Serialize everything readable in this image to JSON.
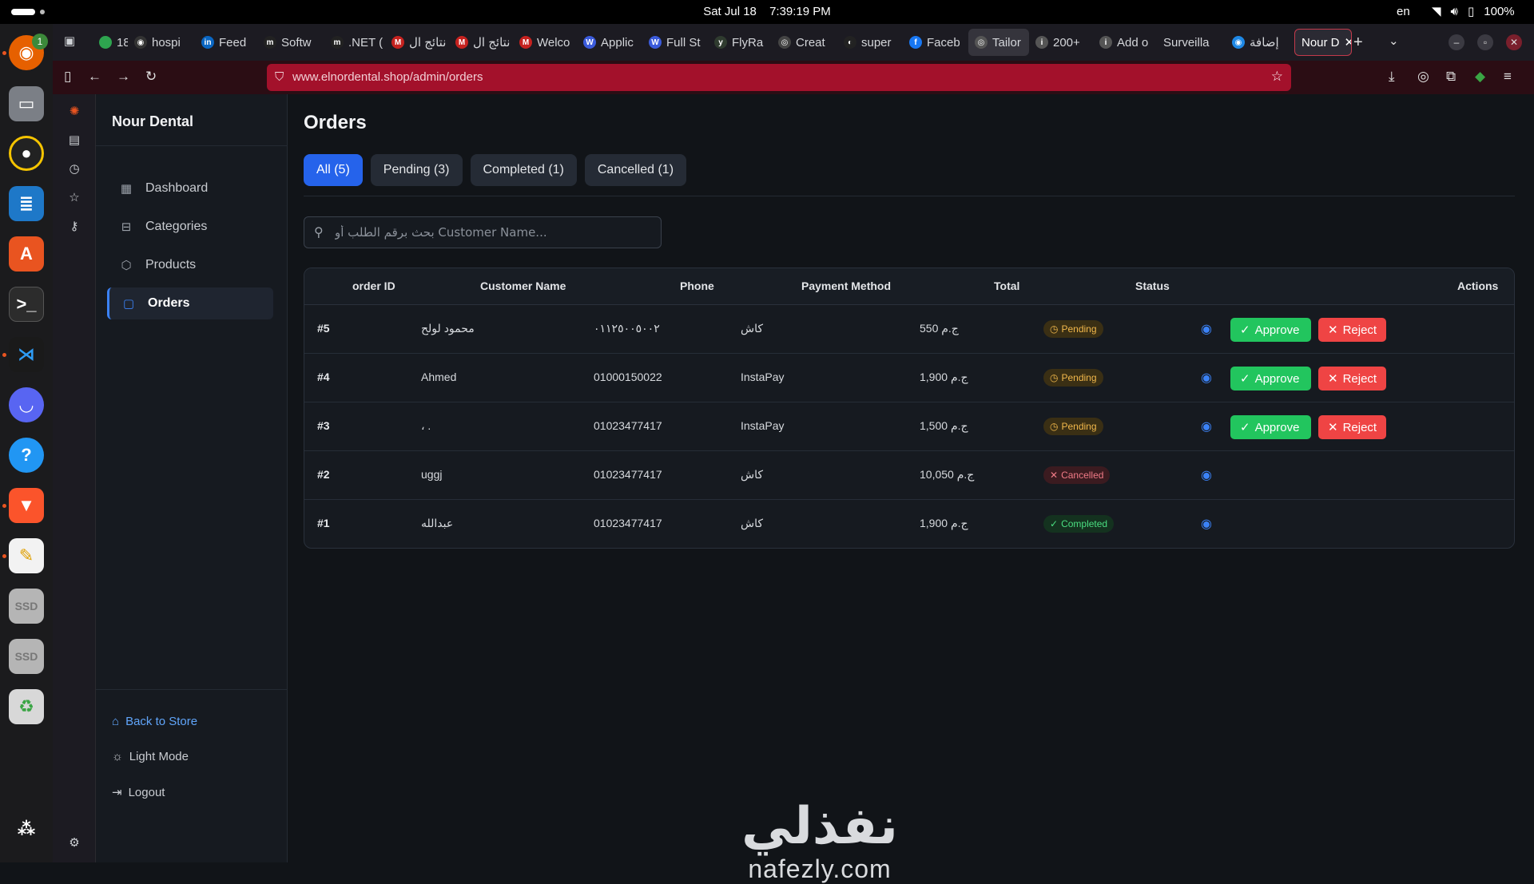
{
  "system": {
    "date": "Sat Jul 18",
    "time": "7:39:19 PM",
    "lang": "en",
    "battery": "100%"
  },
  "dock": {
    "firefox_badge": "1"
  },
  "browser": {
    "tabs": [
      {
        "label": "18",
        "fav": "#2ea44f",
        "favtext": ""
      },
      {
        "label": "hospi",
        "fav": "#333",
        "favtext": "◉"
      },
      {
        "label": "Feed",
        "fav": "#0a66c2",
        "favtext": "in"
      },
      {
        "label": "Softw",
        "fav": "#222",
        "favtext": "m"
      },
      {
        "label": ".NET (",
        "fav": "#222",
        "favtext": "m"
      },
      {
        "label": "نتائج ال",
        "fav": "#c5221f",
        "favtext": "M"
      },
      {
        "label": "نتائج ال",
        "fav": "#c5221f",
        "favtext": "M"
      },
      {
        "label": "Welco",
        "fav": "#c5221f",
        "favtext": "M"
      },
      {
        "label": "Applic",
        "fav": "#3b5bdb",
        "favtext": "W"
      },
      {
        "label": "Full St",
        "fav": "#3b5bdb",
        "favtext": "W"
      },
      {
        "label": "FlyRa",
        "fav": "#2f3b2f",
        "favtext": "y"
      },
      {
        "label": "Creat",
        "fav": "#444",
        "favtext": "◎"
      },
      {
        "label": "super",
        "fav": "#222",
        "favtext": "◐"
      },
      {
        "label": "Faceb",
        "fav": "#1877f2",
        "favtext": "f"
      },
      {
        "label": "Tailor",
        "fav": "#555",
        "favtext": "◎"
      },
      {
        "label": "200+",
        "fav": "#555",
        "favtext": "i"
      },
      {
        "label": "Add o",
        "fav": "#555",
        "favtext": "i"
      },
      {
        "label": "Surveilla",
        "fav": "transparent",
        "favtext": ""
      },
      {
        "label": "إضافة",
        "fav": "#1e88e5",
        "favtext": "◉"
      },
      {
        "label": "Nour D",
        "fav": "transparent",
        "favtext": ""
      }
    ],
    "url": "www.elnordental.shop/admin/orders"
  },
  "sidebar": {
    "brand": "Nour Dental",
    "items": [
      {
        "label": "Dashboard",
        "icon": "grid-icon"
      },
      {
        "label": "Categories",
        "icon": "categories-icon"
      },
      {
        "label": "Products",
        "icon": "box-icon"
      },
      {
        "label": "Orders",
        "icon": "orders-icon"
      }
    ],
    "back_to_store": "Back to Store",
    "light_mode": "Light Mode",
    "logout": "Logout"
  },
  "main": {
    "title": "Orders",
    "filters": [
      "All (5)",
      "Pending (3)",
      "Completed (1)",
      "Cancelled (1)"
    ],
    "search_placeholder": "بحث برقم الطلب أو Customer Name...",
    "columns": {
      "order_id": "order ID",
      "customer": "Customer Name",
      "phone": "Phone",
      "payment": "Payment Method",
      "total": "Total",
      "status": "Status",
      "actions": "Actions"
    },
    "rows": [
      {
        "id": "#5",
        "customer": "محمود لولح",
        "phone": "٠١١٢٥٠٠٥٠٠٢",
        "payment": "كاش",
        "total": "550 ج.م",
        "status": "Pending",
        "status_key": "pending",
        "actions": true
      },
      {
        "id": "#4",
        "customer": "Ahmed",
        "phone": "01000150022",
        "payment": "InstaPay",
        "total": "1,900 ج.م",
        "status": "Pending",
        "status_key": "pending",
        "actions": true
      },
      {
        "id": "#3",
        "customer": "، .",
        "phone": "01023477417",
        "payment": "InstaPay",
        "total": "1,500 ج.م",
        "status": "Pending",
        "status_key": "pending",
        "actions": true
      },
      {
        "id": "#2",
        "customer": "uggj",
        "phone": "01023477417",
        "payment": "كاش",
        "total": "10,050 ج.م",
        "status": "Cancelled",
        "status_key": "cancelled",
        "actions": false
      },
      {
        "id": "#1",
        "customer": "عبدالله",
        "phone": "01023477417",
        "payment": "كاش",
        "total": "1,900 ج.م",
        "status": "Completed",
        "status_key": "completed",
        "actions": false
      }
    ],
    "approve_label": "Approve",
    "reject_label": "Reject"
  },
  "watermark": {
    "arabic": "نفذلي",
    "latin": "nafezly.com"
  },
  "colors": {
    "accent": "#2563eb",
    "approve": "#22c55e",
    "reject": "#ef4444",
    "pending": "#f2b84b",
    "cancelled": "#f07a86",
    "completed": "#4ade80"
  }
}
